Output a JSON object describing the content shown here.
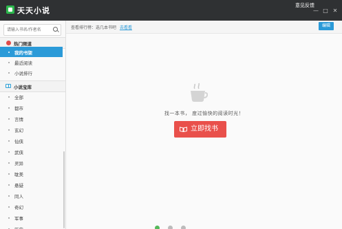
{
  "window": {
    "title": "天天小说",
    "feedback": "意见反馈",
    "controls": [
      "minimize",
      "maximize",
      "close"
    ]
  },
  "sidebar": {
    "search_placeholder": "请输入书名/作者名",
    "sections": [
      {
        "title": "热门频道",
        "icon": "hot-icon",
        "items": [
          {
            "label": "我的书架",
            "active": true
          },
          {
            "label": "最近阅读",
            "active": false
          },
          {
            "label": "小说排行",
            "active": false
          }
        ]
      },
      {
        "title": "小说宝库",
        "icon": "book-icon",
        "items": [
          {
            "label": "全部"
          },
          {
            "label": "都市"
          },
          {
            "label": "言情"
          },
          {
            "label": "玄幻"
          },
          {
            "label": "仙侠"
          },
          {
            "label": "武侠"
          },
          {
            "label": "灵异"
          },
          {
            "label": "耽美"
          },
          {
            "label": "悬疑"
          },
          {
            "label": "同人"
          },
          {
            "label": "奇幻"
          },
          {
            "label": "军事"
          },
          {
            "label": "历史"
          }
        ]
      }
    ]
  },
  "content": {
    "breadcrumb_text": "查看排行榜：选几本书吧",
    "breadcrumb_link": "去看看",
    "switch_button": "编辑",
    "empty_message": "找一本书， 度过愉快的阅读时光！",
    "find_button": "立即找书",
    "pager_dots": 3,
    "pager_active": 0
  },
  "colors": {
    "titlebar": "#2f3133",
    "accent_blue": "#2b9ad8",
    "button_red": "#e9504b",
    "logo_green": "#2db84d"
  }
}
